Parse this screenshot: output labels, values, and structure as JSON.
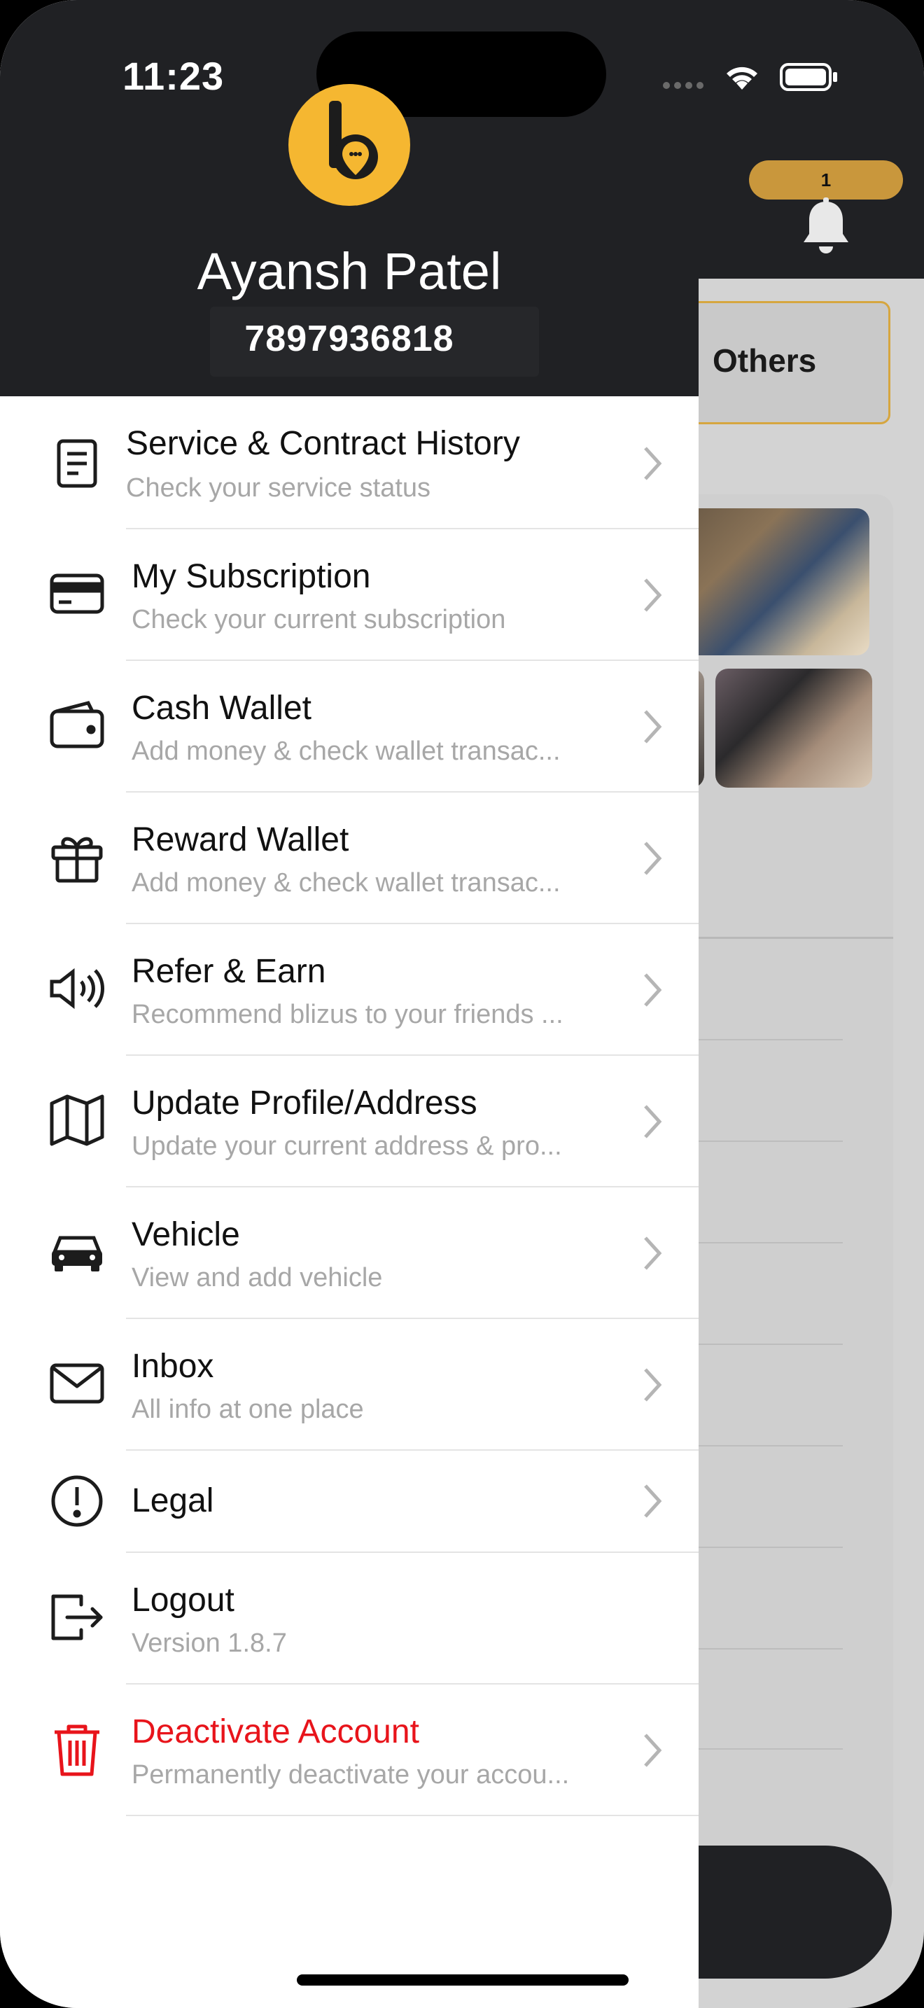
{
  "status_bar": {
    "time": "11:23"
  },
  "drawer": {
    "user": {
      "name": "Ayansh Patel",
      "phone": "7897936818"
    },
    "items": [
      {
        "title": "Service & Contract History",
        "subtitle": "Check your service status",
        "icon": "document-icon"
      },
      {
        "title": "My Subscription",
        "subtitle": "Check your current subscription",
        "icon": "credit-card-icon"
      },
      {
        "title": "Cash Wallet",
        "subtitle": "Add money & check wallet transac...",
        "icon": "wallet-icon"
      },
      {
        "title": "Reward Wallet",
        "subtitle": "Add money & check wallet transac...",
        "icon": "gift-icon"
      },
      {
        "title": "Refer & Earn",
        "subtitle": "Recommend blizus to your friends ...",
        "icon": "speaker-icon"
      },
      {
        "title": "Update Profile/Address",
        "subtitle": "Update your current address & pro...",
        "icon": "map-icon"
      },
      {
        "title": "Vehicle",
        "subtitle": "View and add vehicle",
        "icon": "car-icon"
      },
      {
        "title": "Inbox",
        "subtitle": "All info at one place",
        "icon": "envelope-icon"
      },
      {
        "title": "Legal",
        "subtitle": "",
        "icon": "exclamation-circle-icon"
      },
      {
        "title": "Logout",
        "subtitle": "Version 1.8.7",
        "icon": "logout-icon"
      },
      {
        "title": "Deactivate Account",
        "subtitle": "Permanently deactivate your accou...",
        "icon": "trash-icon",
        "color": "#e8141b"
      }
    ]
  },
  "background": {
    "notification_count": "1",
    "tab_label": "Others"
  },
  "colors": {
    "header_bg": "#202124",
    "brand_yellow": "#f5b731",
    "badge": "#c9973c",
    "danger": "#e8141b"
  }
}
